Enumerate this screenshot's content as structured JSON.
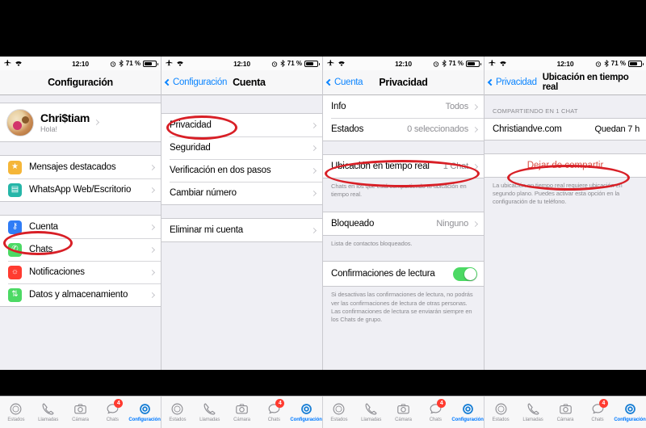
{
  "statusbar": {
    "time": "12:10",
    "battery_pct": "71 %"
  },
  "panels": [
    {
      "id": "settings",
      "nav": {
        "title": "Configuración",
        "back": ""
      },
      "profile": {
        "name": "Chri$tiam",
        "status": "Hola!"
      },
      "groups": [
        {
          "rows": [
            {
              "label": "Mensajes destacados",
              "icon": "star-icon",
              "color": "#f5b638",
              "glyph": "★"
            },
            {
              "label": "WhatsApp Web/Escritorio",
              "icon": "laptop-icon",
              "color": "#25b6a8",
              "glyph": "▤"
            }
          ]
        },
        {
          "rows": [
            {
              "label": "Cuenta",
              "icon": "key-icon",
              "color": "#2f7cf6",
              "glyph": "⚷"
            },
            {
              "label": "Chats",
              "icon": "whatsapp-icon",
              "color": "#4cd964",
              "glyph": "✆"
            },
            {
              "label": "Notificaciones",
              "icon": "bell-icon",
              "color": "#ff3b30",
              "glyph": "🔔"
            },
            {
              "label": "Datos y almacenamiento",
              "icon": "arrows-icon",
              "color": "#4cd964",
              "glyph": "⇅"
            }
          ]
        }
      ]
    },
    {
      "id": "cuenta",
      "nav": {
        "title": "Cuenta",
        "back": "Configuración"
      },
      "groups": [
        {
          "rows": [
            {
              "label": "Privacidad"
            },
            {
              "label": "Seguridad"
            },
            {
              "label": "Verificación en dos pasos"
            },
            {
              "label": "Cambiar número"
            }
          ]
        },
        {
          "rows": [
            {
              "label": "Eliminar mi cuenta"
            }
          ]
        }
      ]
    },
    {
      "id": "privacidad",
      "nav": {
        "title": "Privacidad",
        "back": "Cuenta"
      },
      "rows_top": [
        {
          "label": "Info",
          "value": "Todos"
        },
        {
          "label": "Estados",
          "value": "0 seleccionados"
        }
      ],
      "location_row": {
        "label": "Ubicación en tiempo real",
        "value": "1 Chat"
      },
      "location_foot": "Chats en los que está compartiendo tu ubicación en tiempo real.",
      "blocked_row": {
        "label": "Bloqueado",
        "value": "Ninguno"
      },
      "blocked_foot": "Lista de contactos bloqueados.",
      "receipts_row": {
        "label": "Confirmaciones de lectura",
        "toggle": "on"
      },
      "receipts_foot": "Si desactivas las confirmaciones de lectura, no podrás ver las confirmaciones de lectura de otras personas. Las confirmaciones de lectura se enviarán siempre en los Chats de grupo."
    },
    {
      "id": "ubicacion",
      "nav": {
        "title": "Ubicación en tiempo real",
        "back": "Privacidad"
      },
      "section_header": "COMPARTIENDO EN 1 CHAT",
      "share_row": {
        "label": "Christiandve.com",
        "value": "Quedan 7 h"
      },
      "stop_button": "Dejar de compartir",
      "foot": "La ubicación en tiempo real requiere ubicación en segundo plano. Puedes activar esta opción en la configuración de tu teléfono."
    }
  ],
  "tabbar": {
    "items": [
      {
        "label": "Estados",
        "icon": "status-ring-icon",
        "active": false,
        "badge": ""
      },
      {
        "label": "Llamadas",
        "icon": "phone-icon",
        "active": false,
        "badge": ""
      },
      {
        "label": "Cámara",
        "icon": "camera-icon",
        "active": false,
        "badge": ""
      },
      {
        "label": "Chats",
        "icon": "chat-bubble-icon",
        "active": false,
        "badge": "4"
      },
      {
        "label": "Configuración",
        "icon": "gear-icon",
        "active": true,
        "badge": ""
      }
    ]
  },
  "colors": {
    "accent": "#007aff",
    "annotation": "#d81f26",
    "toggle_on": "#4cd964",
    "destructive": "#d94f45"
  }
}
